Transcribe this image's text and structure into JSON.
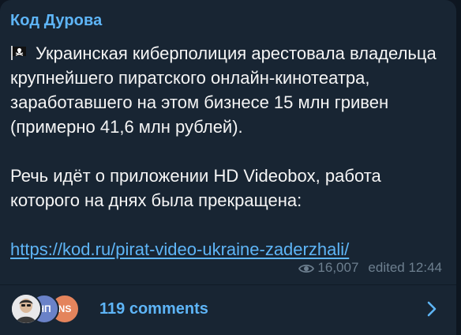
{
  "channel": {
    "title": "Код Дурова"
  },
  "message": {
    "flag_icon": "pirate-flag-icon",
    "paragraph_1": "Украинская киберполиция арестовала владельца крупнейшего пиратского онлайн-кинотеатра, заработавшего на этом бизнесе 15 млн гривен (примерно 41,6 млн рублей).",
    "paragraph_2": "Речь идёт о приложении HD Videobox, работа которого на днях была прекращена:",
    "link": "https://kod.ru/pirat-video-ukraine-zaderzhali/"
  },
  "meta": {
    "views_icon": "eye-icon",
    "views": "16,007",
    "edited": "edited 12:44"
  },
  "comments": {
    "avatars": [
      {
        "initials": "",
        "color": "#e8e8ea"
      },
      {
        "initials": "НП",
        "color": "#6a82c8"
      },
      {
        "initials": "NS",
        "color": "#e4845c"
      }
    ],
    "label": "119 comments",
    "chevron_icon": "chevron-right-icon"
  },
  "colors": {
    "accent": "#5eb5f7",
    "card_bg": "#182533",
    "text": "#f5f5f5",
    "meta_text": "#6d7f8f"
  }
}
